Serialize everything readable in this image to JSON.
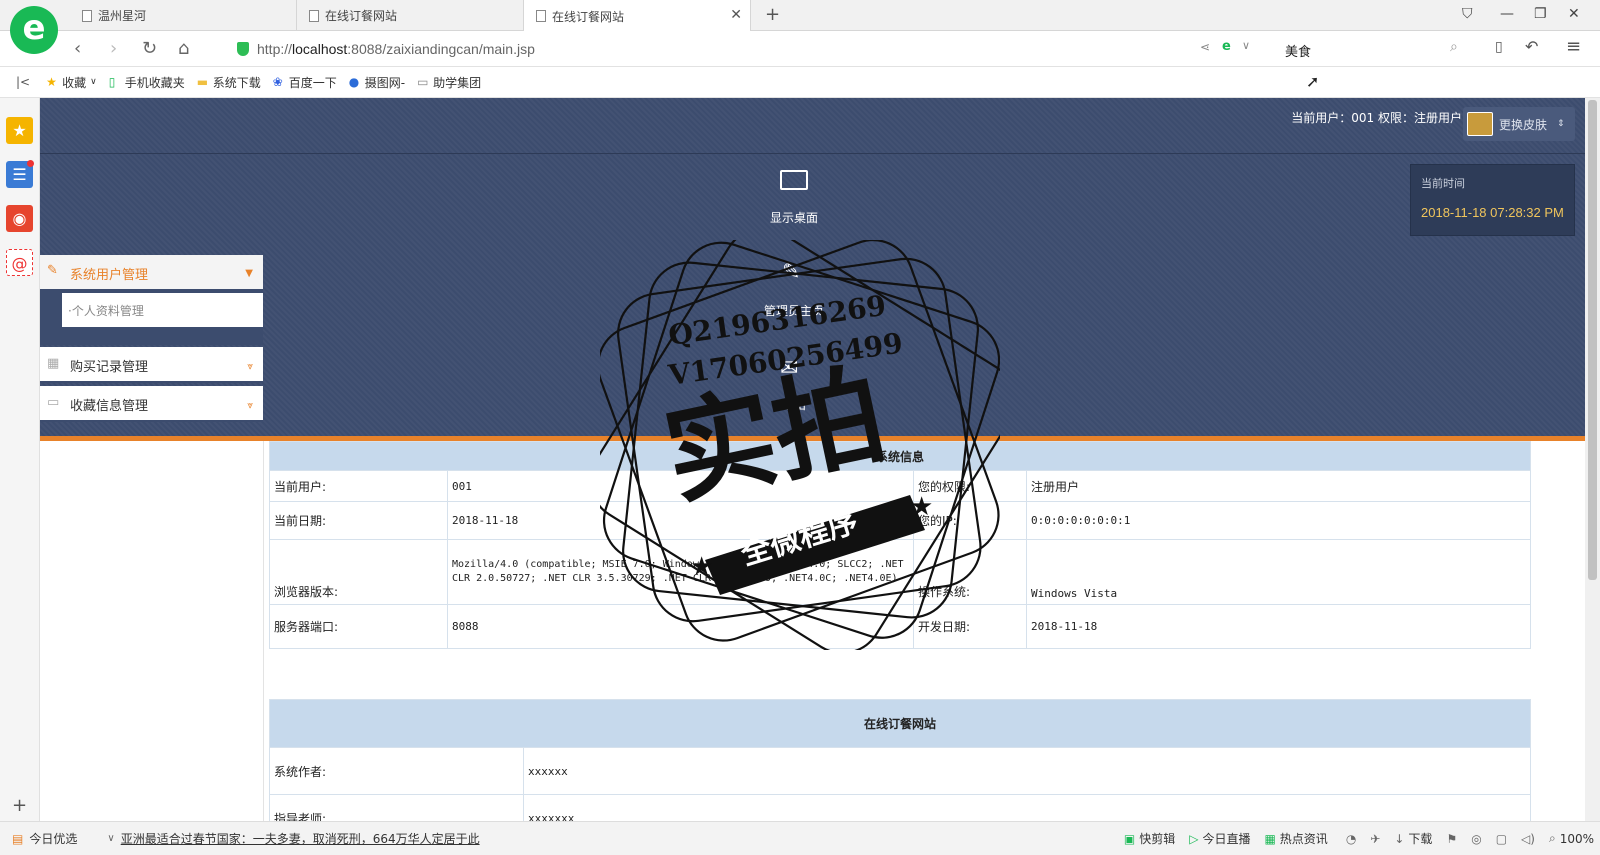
{
  "browser": {
    "tabs": [
      {
        "label": "温州星河"
      },
      {
        "label": "在线订餐网站"
      },
      {
        "label": "在线订餐网站"
      }
    ],
    "url_prefix": "http://",
    "url_host": "localhost",
    "url_rest": ":8088/zaixiandingcan/main.jsp",
    "search_text": "美食",
    "bookmarks": [
      "收藏",
      "手机收藏夹",
      "系统下载",
      "百度一下",
      "摄图网-",
      "助学集团"
    ]
  },
  "header": {
    "user_info": "当前用户：001 权限：注册用户",
    "skin_label": "更换皮肤",
    "time_label": "当前时间",
    "time_value": "2018-11-18 07:28:32 PM",
    "nav": [
      "显示桌面",
      "管理员主页",
      "退出"
    ]
  },
  "sidebar": {
    "items": [
      {
        "label": "系统用户管理",
        "expanded": true
      },
      {
        "label": "个人资料管理"
      },
      {
        "label": "购买记录管理"
      },
      {
        "label": "收藏信息管理"
      }
    ]
  },
  "info_table": {
    "title": "系统信息",
    "rows": [
      {
        "k1": "当前用户:",
        "v1": "001",
        "k2": "您的权限:",
        "v2": "注册用户"
      },
      {
        "k1": "当前日期:",
        "v1": "2018-11-18",
        "k2": "您的IP:",
        "v2": "0:0:0:0:0:0:0:1"
      },
      {
        "k1": "浏览器版本:",
        "v1": "Mozilla/4.0 (compatible; MSIE 7.0; Windows NT 6.0; Trident/4.0; SLCC2; .NET CLR 2.0.50727; .NET CLR 3.5.30729; .NET CLR 3.0.30729; .NET4.0C; .NET4.0E)",
        "k2": "操作系统:",
        "v2": "Windows Vista"
      },
      {
        "k1": "服务器端口:",
        "v1": "8088",
        "k2": "开发日期:",
        "v2": "2018-11-18"
      }
    ]
  },
  "site_table": {
    "title": "在线订餐网站",
    "rows": [
      {
        "k": "系统作者:",
        "v": "xxxxxx"
      },
      {
        "k": "指导老师:",
        "v": "xxxxxxx"
      }
    ]
  },
  "watermark": {
    "qq": "Q2196316269",
    "vx": "V17060256499",
    "big": "实拍",
    "banner": "全微程序"
  },
  "statusbar": {
    "left": "今日优选",
    "news": "亚洲最适合过春节国家：一夫多妻，取消死刑，664万华人定居于此",
    "items": [
      "快剪辑",
      "今日直播",
      "热点资讯",
      "下载",
      "100%"
    ]
  }
}
